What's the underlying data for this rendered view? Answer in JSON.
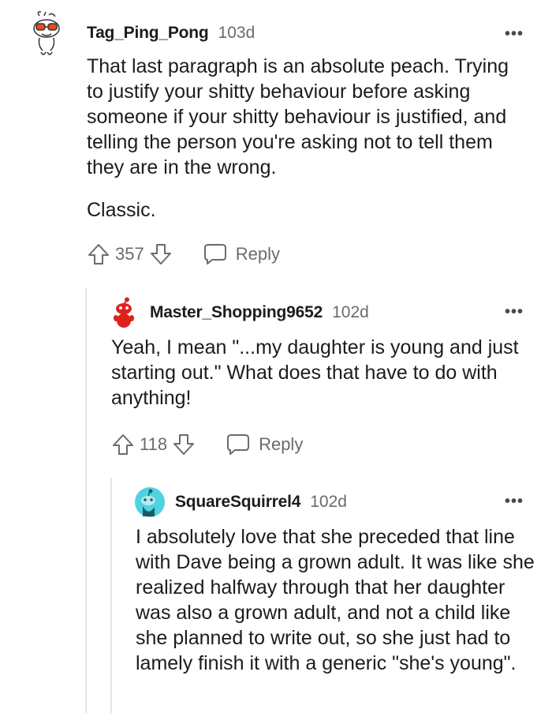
{
  "comments": [
    {
      "username": "Tag_Ping_Pong",
      "age": "103d",
      "more": "•••",
      "paragraphs": [
        "That last paragraph is an absolute peach. Trying to justify your shitty behaviour before asking someone if your shitty behaviour is justified, and telling the person you're asking not to tell them they are in the wrong.",
        "Classic."
      ],
      "votes": "357",
      "reply_label": "Reply",
      "avatar": "snoo-glasses-sketch-icon"
    },
    {
      "username": "Master_Shopping9652",
      "age": "102d",
      "more": "•••",
      "paragraphs": [
        "Yeah, I mean \"...my daughter is young and just starting out.\" What does that have to do with anything!"
      ],
      "votes": "118",
      "reply_label": "Reply",
      "avatar": "snoo-red-icon"
    },
    {
      "username": "SquareSquirrel4",
      "age": "102d",
      "more": "•••",
      "paragraphs": [
        "I absolutely love that she preceded that line with Dave being a grown adult. It was like she realized halfway through that her daughter was also a grown adult, and not a child like she planned to write out, so she just had to lamely finish it with a generic \"she's young\"."
      ],
      "avatar": "snoo-teal-circle-icon"
    }
  ],
  "colors": {
    "text": "#1c1c1c",
    "meta": "#6b6b6b",
    "thread_line": "#e6e6e6",
    "avatar_red": "#e0201c",
    "avatar_teal": "#4fd3e0"
  }
}
